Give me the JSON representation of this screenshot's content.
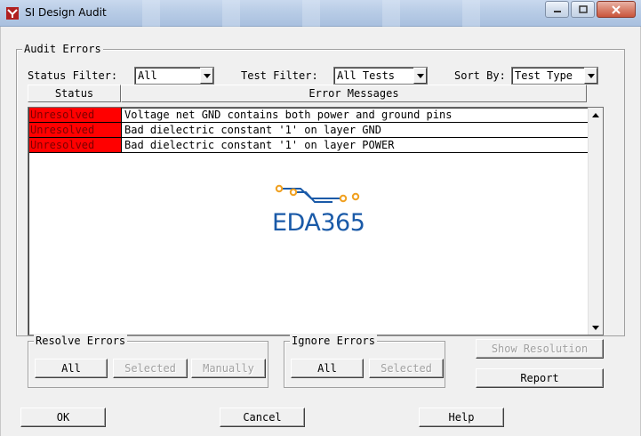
{
  "window": {
    "title": "SI Design Audit",
    "icon": "si-audit-app-icon",
    "controls": [
      "minimize-icon",
      "maximize-icon",
      "close-icon"
    ]
  },
  "audit_errors": {
    "group_label": "Audit Errors",
    "status_filter": {
      "label": "Status Filter:",
      "value": "All"
    },
    "test_filter": {
      "label": "Test Filter:",
      "value": "All Tests"
    },
    "sort_by": {
      "label": "Sort By:",
      "value": "Test Type"
    },
    "columns": [
      "Status",
      "Error Messages"
    ],
    "rows": [
      {
        "status": "Unresolved",
        "message": "Voltage net GND contains both power and ground pins"
      },
      {
        "status": "Unresolved",
        "message": "Bad dielectric constant '1' on layer GND"
      },
      {
        "status": "Unresolved",
        "message": "Bad dielectric constant '1' on layer POWER"
      }
    ],
    "status_color": "#ff0000"
  },
  "watermark": {
    "text": "EDA365",
    "color": "#1a5aa8",
    "accent": "#f0a020"
  },
  "resolve_errors": {
    "group_label": "Resolve Errors",
    "buttons": {
      "all": "All",
      "selected": "Selected",
      "manually": "Manually"
    }
  },
  "ignore_errors": {
    "group_label": "Ignore Errors",
    "buttons": {
      "all": "All",
      "selected": "Selected"
    }
  },
  "show_resolution": "Show Resolution",
  "report": "Report",
  "footer": {
    "ok": "OK",
    "cancel": "Cancel",
    "help": "Help"
  }
}
